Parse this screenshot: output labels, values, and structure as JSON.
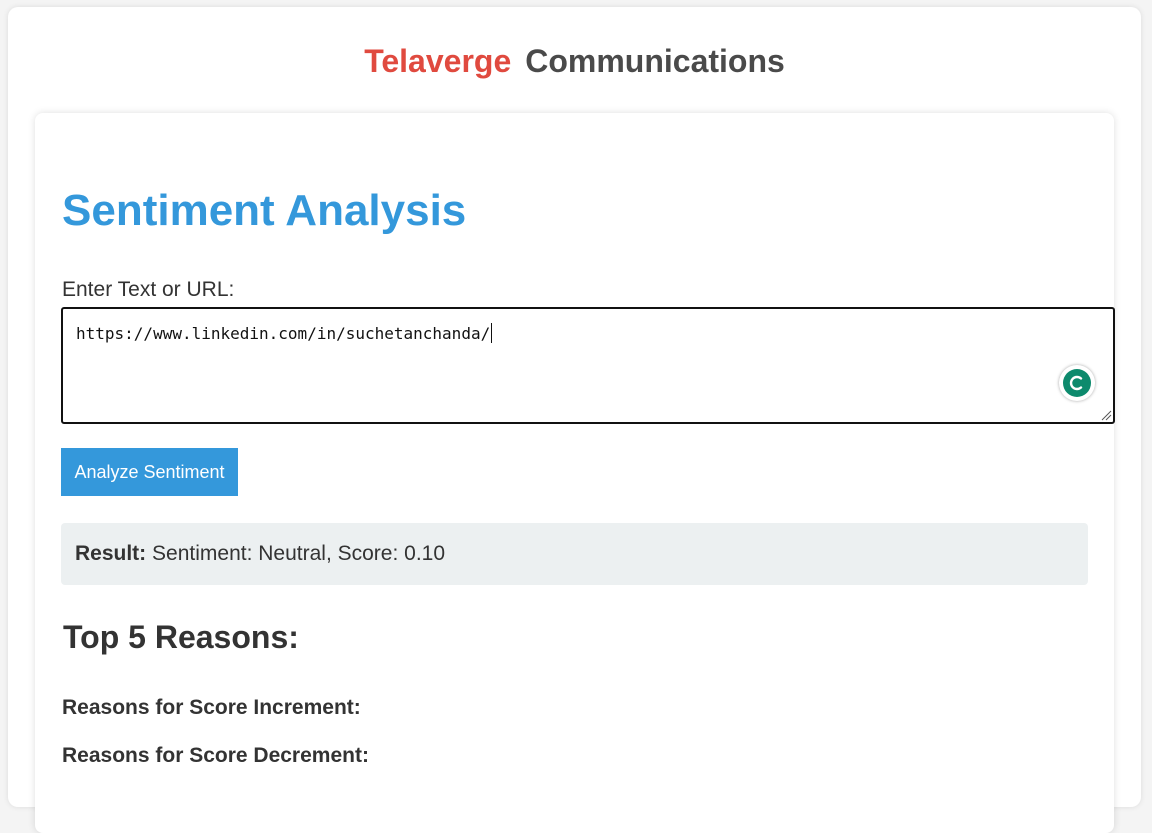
{
  "header": {
    "brand_primary": "Telaverge",
    "brand_secondary": "Communications"
  },
  "main": {
    "title": "Sentiment Analysis",
    "input_label": "Enter Text or URL:",
    "input_value": "https://www.linkedin.com/in/suchetanchanda/",
    "analyze_button_label": "Analyze Sentiment",
    "result_label": "Result:",
    "result_text": "Sentiment: Neutral, Score: 0.10",
    "reasons_title": "Top 5 Reasons:",
    "increment_heading": "Reasons for Score Increment:",
    "decrement_heading": "Reasons for Score Decrement:"
  },
  "colors": {
    "brand_red": "#e04a3f",
    "accent_blue": "#3498db",
    "result_bg": "#ecf0f1",
    "grammar_badge": "#0d8a6d"
  },
  "icons": {
    "grammar_badge": "grammar-assistant-icon",
    "resize": "resize-handle-icon"
  }
}
